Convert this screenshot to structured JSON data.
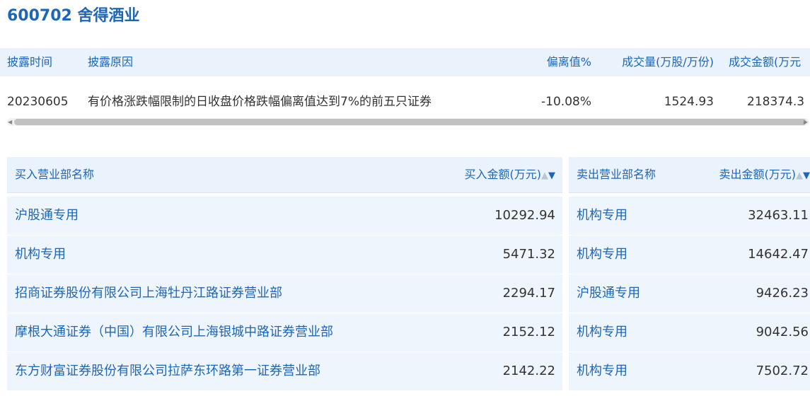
{
  "page_title": "600702 舍得酒业",
  "summary": {
    "headers": {
      "date": "披露时间",
      "reason": "披露原因",
      "deviation": "偏离值%",
      "volume": "成交量(万股/万份)",
      "amount": "成交金额(万元"
    },
    "row": {
      "date": "20230605",
      "reason": "有价格涨跌幅限制的日收盘价格跌幅偏离值达到7%的前五只证券",
      "deviation": "-10.08%",
      "volume": "1524.93",
      "amount": "218374.3"
    }
  },
  "buy_table": {
    "header_name": "买入营业部名称",
    "header_amount": "买入金额(万元)",
    "sort_up": "▲",
    "sort_down": "▼",
    "rows": [
      {
        "name": "沪股通专用",
        "amount": "10292.94"
      },
      {
        "name": "机构专用",
        "amount": "5471.32"
      },
      {
        "name": "招商证券股份有限公司上海牡丹江路证券营业部",
        "amount": "2294.17"
      },
      {
        "name": "摩根大通证券（中国）有限公司上海银城中路证券营业部",
        "amount": "2152.12"
      },
      {
        "name": "东方财富证券股份有限公司拉萨东环路第一证券营业部",
        "amount": "2142.22"
      }
    ]
  },
  "sell_table": {
    "header_name": "卖出营业部名称",
    "header_amount": "卖出金额(万元)",
    "sort_up": "▲",
    "sort_down": "▼",
    "rows": [
      {
        "name": "机构专用",
        "amount": "32463.11"
      },
      {
        "name": "机构专用",
        "amount": "14642.47"
      },
      {
        "name": "沪股通专用",
        "amount": "9426.23"
      },
      {
        "name": "机构专用",
        "amount": "9042.56"
      },
      {
        "name": "机构专用",
        "amount": "7502.72"
      }
    ]
  },
  "scrollbar": {
    "left_arrow": "◀",
    "right_arrow": "▶"
  }
}
